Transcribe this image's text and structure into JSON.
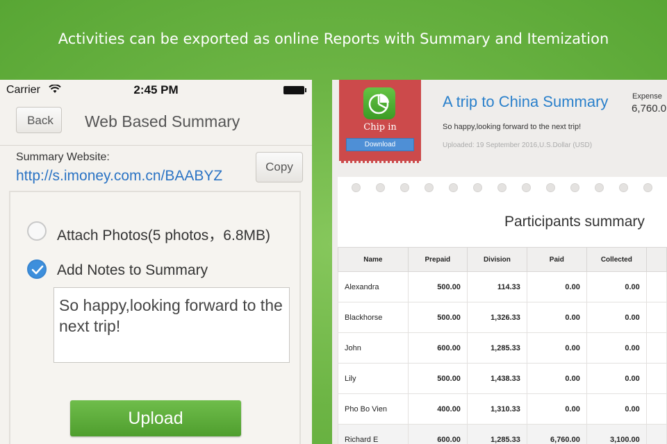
{
  "banner": {
    "text": "Activities can be exported as online Reports with Summary and Itemization"
  },
  "phone": {
    "status": {
      "carrier": "Carrier",
      "time": "2:45 PM"
    },
    "nav": {
      "back_label": "Back",
      "title": "Web Based Summary"
    },
    "summary_label": "Summary Website:",
    "summary_url": "http://s.imoney.com.cn/BAABYZ",
    "copy_label": "Copy",
    "options": [
      {
        "label": "Attach Photos(5 photos，6.8MB)",
        "checked": false
      },
      {
        "label": "Add Notes to Summary",
        "checked": true
      }
    ],
    "notes_text": "So happy,looking forward to the next trip!",
    "upload_label": "Upload"
  },
  "report": {
    "app_name": "Chip in",
    "download_label": "Download",
    "title": "A trip to China Summary",
    "subtitle": "So happy,looking forward to the next trip!",
    "uploaded": "Uploaded: 19 September 2016,U.S.Dollar (USD)",
    "expense_label": "Expense",
    "expense_value": "6,760.0",
    "sheet_title": "Participants summary",
    "table": {
      "headers": [
        "Name",
        "Prepaid",
        "Division",
        "Paid",
        "Collected"
      ],
      "rows": [
        [
          "Alexandra",
          "500.00",
          "114.33",
          "0.00",
          "0.00"
        ],
        [
          "Blackhorse",
          "500.00",
          "1,326.33",
          "0.00",
          "0.00"
        ],
        [
          "John",
          "600.00",
          "1,285.33",
          "0.00",
          "0.00"
        ],
        [
          "Lily",
          "500.00",
          "1,438.33",
          "0.00",
          "0.00"
        ],
        [
          "Pho Bo Vien",
          "400.00",
          "1,310.33",
          "0.00",
          "0.00"
        ],
        [
          "Richard E",
          "600.00",
          "1,285.33",
          "6,760.00",
          "3,100.00"
        ]
      ]
    }
  },
  "colors": {
    "background": "#6db545",
    "link": "#2a73c4",
    "checkbox": "#3d8fdc",
    "upload": "#5aa838",
    "ribbon": "#cc4a4b"
  }
}
